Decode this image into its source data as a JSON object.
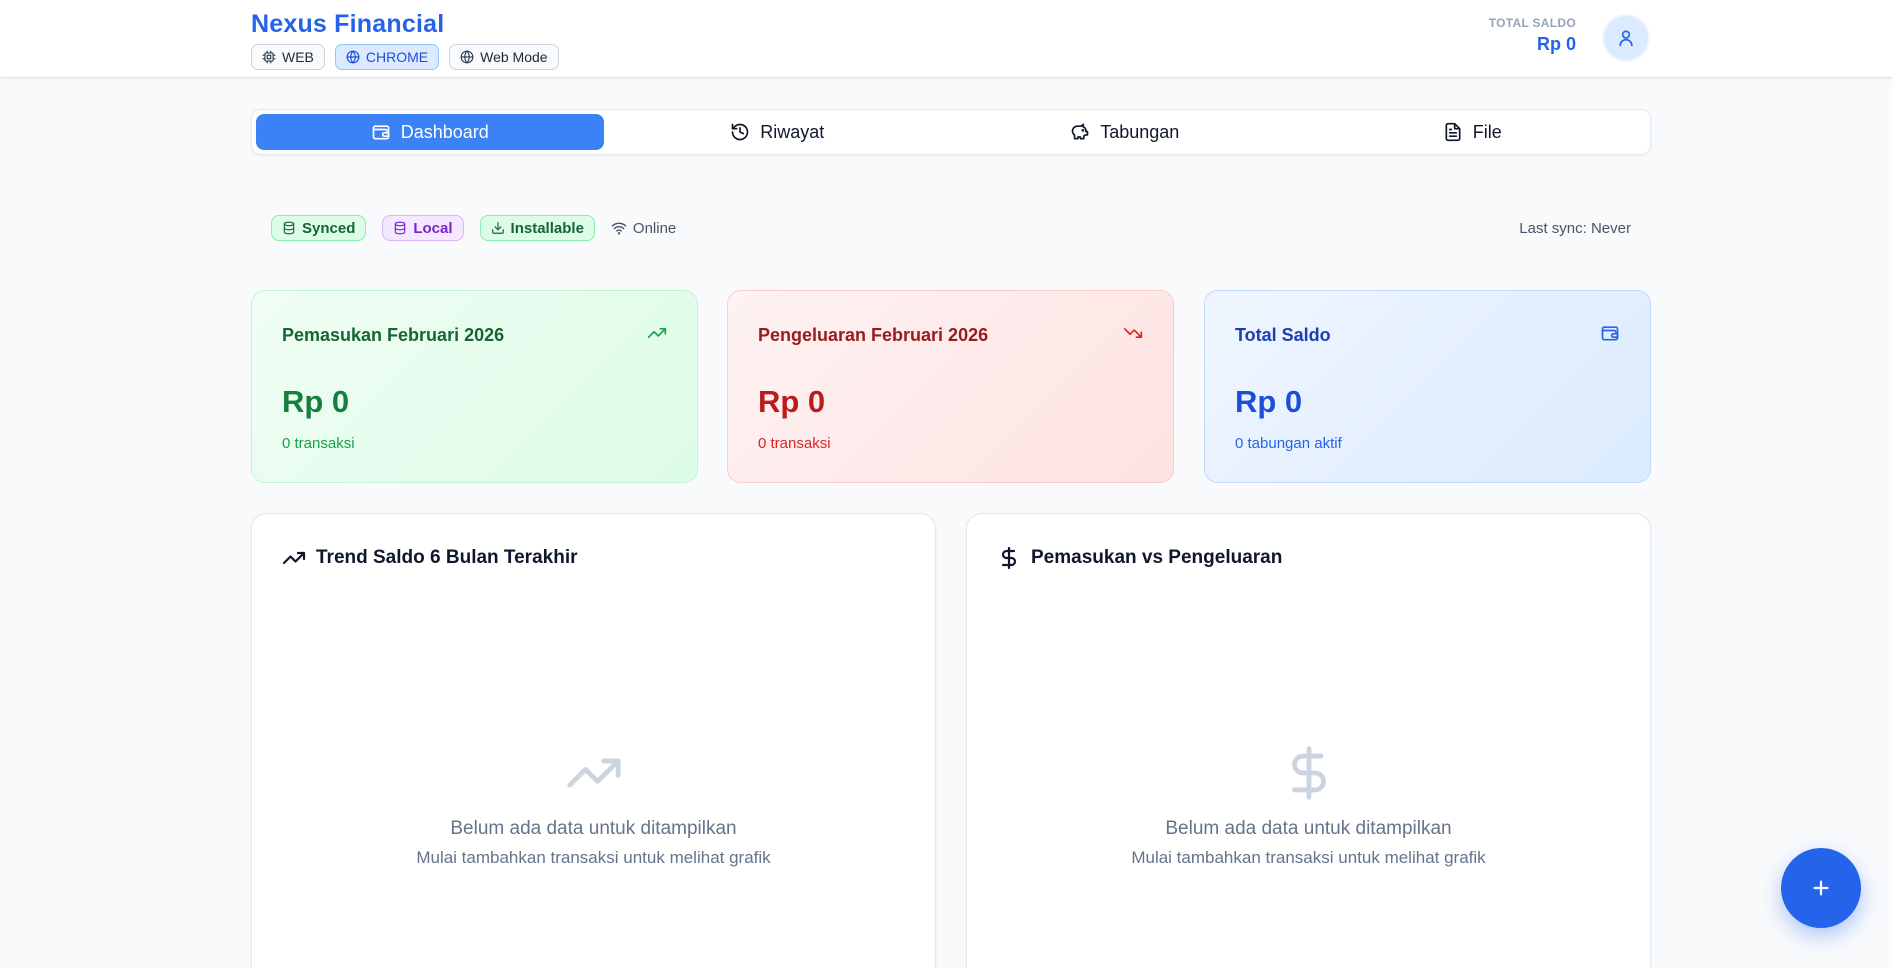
{
  "header": {
    "brand": "Nexus Financial",
    "env_badges": [
      {
        "label": "WEB",
        "icon": "cpu-icon",
        "active": false
      },
      {
        "label": "CHROME",
        "icon": "globe-icon",
        "active": true
      },
      {
        "label": "Web Mode",
        "icon": "globe-icon",
        "active": false
      }
    ],
    "total_saldo_label": "TOTAL SALDO",
    "total_saldo_value": "Rp 0",
    "avatar_icon": "user-icon"
  },
  "tabs": [
    {
      "label": "Dashboard",
      "icon": "wallet-icon",
      "active": true
    },
    {
      "label": "Riwayat",
      "icon": "history-icon",
      "active": false
    },
    {
      "label": "Tabungan",
      "icon": "piggy-bank-icon",
      "active": false
    },
    {
      "label": "File",
      "icon": "file-icon",
      "active": false
    }
  ],
  "status": {
    "synced": "Synced",
    "local": "Local",
    "installable": "Installable",
    "online": "Online",
    "last_sync": "Last sync: Never"
  },
  "cards": {
    "income": {
      "title": "Pemasukan Februari 2026",
      "value": "Rp 0",
      "sub": "0 transaksi"
    },
    "expense": {
      "title": "Pengeluaran Februari 2026",
      "value": "Rp 0",
      "sub": "0 transaksi"
    },
    "total": {
      "title": "Total Saldo",
      "value": "Rp 0",
      "sub": "0 tabungan aktif"
    }
  },
  "panels": {
    "trend": {
      "title": "Trend Saldo 6 Bulan Terakhir",
      "empty_title": "Belum ada data untuk ditampilkan",
      "empty_sub": "Mulai tambahkan transaksi untuk melihat grafik"
    },
    "compare": {
      "title": "Pemasukan vs Pengeluaran",
      "empty_title": "Belum ada data untuk ditampilkan",
      "empty_sub": "Mulai tambahkan transaksi untuk melihat grafik"
    }
  },
  "fab": {
    "icon": "plus-icon"
  },
  "colors": {
    "brand": "#2563eb",
    "tab_active": "#3b82f6",
    "income": "#15803d",
    "expense": "#b91c1c",
    "total": "#1d4ed8"
  }
}
